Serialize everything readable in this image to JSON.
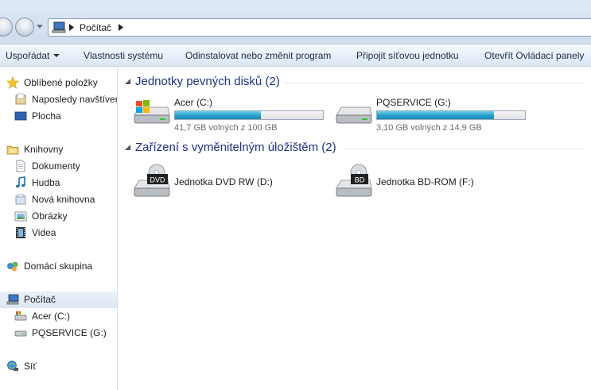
{
  "address": {
    "crumbs": [
      "Počítač"
    ]
  },
  "toolbar": {
    "organize": "Uspořádat",
    "system_properties": "Vlastnosti systému",
    "uninstall": "Odinstalovat nebo změnit program",
    "map_network": "Připojit síťovou jednotku",
    "control_panel": "Otevřít Ovládací panely"
  },
  "sidebar": {
    "favorites": "Oblíbené položky",
    "recent": "Naposledy navštíver",
    "desktop": "Plocha",
    "libraries": "Knihovny",
    "documents": "Dokumenty",
    "music": "Hudba",
    "new_library": "Nová knihovna",
    "pictures": "Obrázky",
    "videos": "Videa",
    "homegroup": "Domácí skupina",
    "computer": "Počítač",
    "drive_c": "Acer (C:)",
    "drive_g": "PQSERVICE (G:)",
    "network": "Síť"
  },
  "groups": {
    "hdd": "Jednotky pevných disků (2)",
    "removable": "Zařízení s vyměnitelným úložištěm (2)"
  },
  "drives": [
    {
      "name": "Acer (C:)",
      "free": "41,7 GB volných z 100 GB",
      "used_fraction": 0.58
    },
    {
      "name": "PQSERVICE (G:)",
      "free": "3,10 GB volných z 14,9 GB",
      "used_fraction": 0.79
    }
  ],
  "removable": [
    {
      "name": "Jednotka DVD RW (D:)",
      "badge": "DVD"
    },
    {
      "name": "Jednotka BD-ROM (F:)",
      "badge": "BD"
    }
  ],
  "colors": {
    "accent_title": "#1e3287",
    "progress": "#26a0c8",
    "selected_bg": "#dce7f3"
  }
}
